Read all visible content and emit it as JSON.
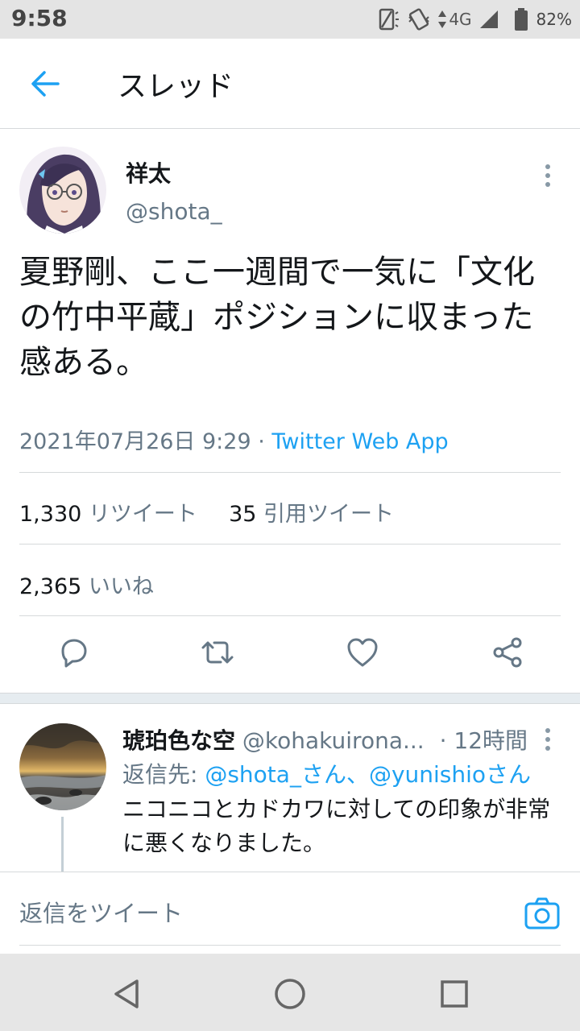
{
  "status_bar": {
    "time": "9:58",
    "network": "4G",
    "battery": "82%"
  },
  "topbar": {
    "back_icon": "arrow-left-icon",
    "title": "スレッド"
  },
  "tweet": {
    "author_name": "祥太",
    "author_handle": "@shota_",
    "text": "夏野剛、ここ一週間で一気に「文化の竹中平蔵」ポジションに収まった感ある。",
    "timestamp": "2021年07月26日 9:29",
    "separator": " · ",
    "source": "Twitter Web App",
    "retweets_count": "1,330",
    "retweets_label": "リツイート",
    "quotes_count": "35",
    "quotes_label": "引用ツイート",
    "likes_count": "2,365",
    "likes_label": "いいね",
    "actions": [
      "reply-icon",
      "retweet-icon",
      "like-icon",
      "share-icon"
    ]
  },
  "reply": {
    "name": "琥珀色な空",
    "handle": "@kohakuirona...",
    "time": "· 12時間",
    "reply_to_prefix": "返信先: ",
    "reply_to_users": "@shota_さん、@yunishioさん",
    "text": "ニコニコとカドカワに対しての印象が非常に悪くなりました。"
  },
  "compose": {
    "placeholder": "返信をツイート",
    "camera_icon": "camera-icon"
  },
  "nav": [
    "back-triangle-icon",
    "home-circle-icon",
    "recents-square-icon"
  ],
  "colors": {
    "accent": "#1da1f2",
    "secondary_text": "#657786",
    "primary_text": "#14171a"
  }
}
